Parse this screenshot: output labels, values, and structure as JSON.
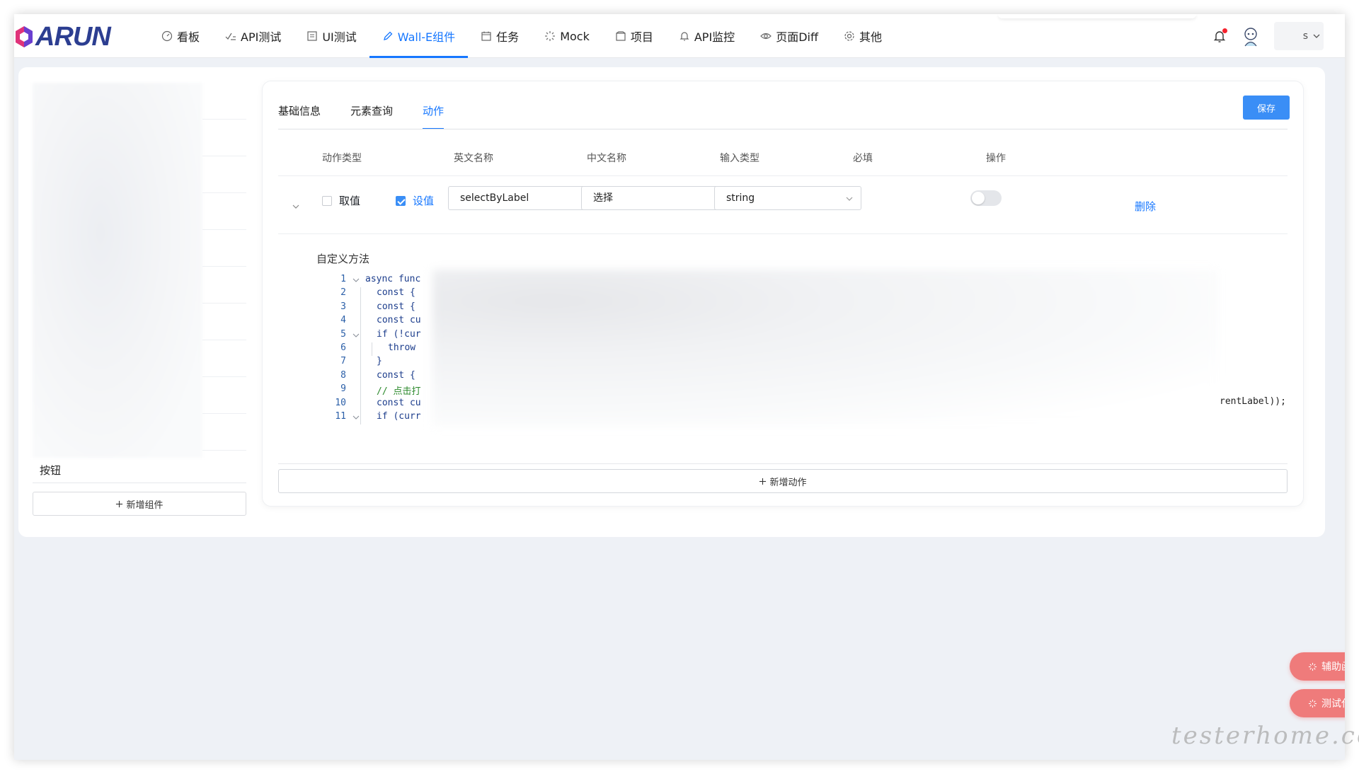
{
  "brand": {
    "logo_text": "ARUN",
    "logo_color": "#2c3e91",
    "accent": "#1677ff"
  },
  "nav": {
    "items": [
      {
        "label": "看板",
        "icon": "dashboard-icon",
        "active": false
      },
      {
        "label": "API测试",
        "icon": "check-list-icon",
        "active": false
      },
      {
        "label": "UI测试",
        "icon": "document-icon",
        "active": false
      },
      {
        "label": "Wall-E组件",
        "icon": "pen-icon",
        "active": true
      },
      {
        "label": "任务",
        "icon": "calendar-icon",
        "active": false
      },
      {
        "label": "Mock",
        "icon": "loading-icon",
        "active": false
      },
      {
        "label": "项目",
        "icon": "folder-icon",
        "active": false
      },
      {
        "label": "API监控",
        "icon": "bell-icon",
        "active": false
      },
      {
        "label": "页面Diff",
        "icon": "eye-icon",
        "active": false
      },
      {
        "label": "其他",
        "icon": "settings-icon",
        "active": false
      }
    ],
    "user_initial": "s"
  },
  "sidebar": {
    "selected_label": "按钮",
    "add_button": "新增组件"
  },
  "editor": {
    "tabs": [
      {
        "label": "基础信息"
      },
      {
        "label": "元素查询"
      },
      {
        "label": "动作"
      }
    ],
    "active_tab": "动作",
    "save_label": "保存",
    "columns": {
      "action_type": "动作类型",
      "en_name": "英文名称",
      "cn_name": "中文名称",
      "input_type": "输入类型",
      "required": "必填",
      "ops": "操作"
    },
    "row": {
      "get_label": "取值",
      "get_checked": false,
      "set_label": "设值",
      "set_checked": true,
      "en_name": "selectByLabel",
      "cn_name": "选择",
      "input_type": "string",
      "required": false,
      "delete_label": "删除"
    },
    "custom_method_label": "自定义方法",
    "code_lines": [
      {
        "n": "1",
        "text": "async func",
        "fold": true,
        "indent": 0
      },
      {
        "n": "2",
        "text": "const {",
        "fold": false,
        "indent": 1
      },
      {
        "n": "3",
        "text": "const {",
        "fold": false,
        "indent": 1
      },
      {
        "n": "4",
        "text": "const cu",
        "fold": false,
        "indent": 1
      },
      {
        "n": "5",
        "text": "if (!cur",
        "fold": true,
        "indent": 1
      },
      {
        "n": "6",
        "text": "throw",
        "fold": false,
        "indent": 2
      },
      {
        "n": "7",
        "text": "}",
        "fold": false,
        "indent": 1
      },
      {
        "n": "8",
        "text": "const {",
        "fold": false,
        "indent": 1
      },
      {
        "n": "9",
        "text": "// 点击打",
        "fold": false,
        "indent": 1,
        "comment": true
      },
      {
        "n": "10",
        "text": "const cu",
        "fold": false,
        "indent": 1
      },
      {
        "n": "11",
        "text": "if (curr",
        "fold": true,
        "indent": 1
      }
    ],
    "code_tail": "rentLabel));",
    "add_action_label": "新增动作"
  },
  "floating": {
    "helper_label": "辅助函数",
    "test_label": "测试代码",
    "color": "#ef7b7b"
  },
  "watermark": "testerhome.com"
}
